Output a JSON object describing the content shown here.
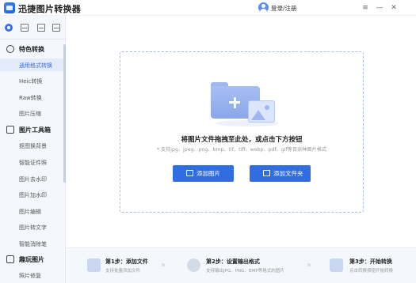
{
  "app": {
    "title": "迅捷图片转换器"
  },
  "header": {
    "login_label": "登录/注册"
  },
  "window_controls": {
    "menu": "≡",
    "minimize": "—",
    "close": "✕"
  },
  "sidebar": {
    "sections": [
      {
        "label": "特色转换",
        "items": [
          "通用格式转换",
          "Heic转换",
          "Raw转换",
          "图片压缩"
        ]
      },
      {
        "label": "图片工具箱",
        "items": [
          "抠图换背景",
          "智能证件照",
          "图片去水印",
          "图片加水印",
          "图片编辑",
          "图片转文字",
          "智能消除笔"
        ]
      },
      {
        "label": "趣玩图片",
        "items": [
          "照片修复"
        ]
      }
    ],
    "active_item": "通用格式转换"
  },
  "dropzone": {
    "title": "将图片文件拖拽至此处，或点击下方按钮",
    "hint": "* 支持jpg、jpeg、png、bmp、tif、tiff、webp、pdf、gif等百余种图片格式"
  },
  "buttons": {
    "add_image": "添加图片",
    "add_folder": "添加文件夹"
  },
  "steps": [
    {
      "title": "第1步：添加文件",
      "sub": "支持批量添加文件"
    },
    {
      "title": "第2步：设置输出格式",
      "sub": "支持输出JPG、PNG、BMP等格式的图片"
    },
    {
      "title": "第3步：开始转换",
      "sub": "点击转换按钮开始转换"
    }
  ],
  "colors": {
    "accent": "#2f6de0",
    "sidebar_bg": "#f4f7fc",
    "active_item_bg": "#e3ebfb"
  }
}
